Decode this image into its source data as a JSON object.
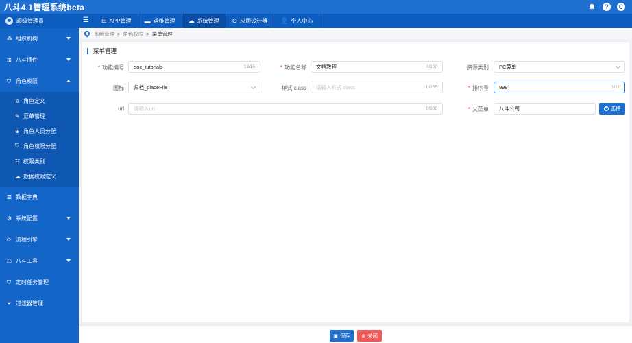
{
  "app": {
    "title": "八斗4.1管理系统beta"
  },
  "top_icons": [
    {
      "name": "bell-icon",
      "glyph": "🔔"
    },
    {
      "name": "help-icon",
      "glyph": "?"
    },
    {
      "name": "logout-icon",
      "glyph": "C"
    }
  ],
  "user": {
    "name": "超级管理员"
  },
  "nav_tabs": [
    {
      "label": "APP管理",
      "icon": "⊞"
    },
    {
      "label": "运维管理",
      "icon": "▬"
    },
    {
      "label": "系统管理",
      "icon": "☁"
    },
    {
      "label": "应用设计器",
      "icon": "⊙"
    },
    {
      "label": "个人中心",
      "icon": "👤"
    }
  ],
  "active_tab": "系统管理",
  "sidebar": {
    "items": [
      {
        "label": "组织机构",
        "icon": "⁂"
      },
      {
        "label": "八斗插件",
        "icon": "⊞"
      },
      {
        "label": "角色权限",
        "icon": "⛉"
      },
      {
        "label": "数据字典",
        "icon": "☰"
      },
      {
        "label": "系统配置",
        "icon": "⚙"
      },
      {
        "label": "流程引擎",
        "icon": "⟳"
      },
      {
        "label": "八斗工具",
        "icon": "☖"
      },
      {
        "label": "定时任务管理",
        "icon": "⛉"
      },
      {
        "label": "过滤器管理",
        "icon": "⏷"
      }
    ],
    "sub_items": [
      {
        "label": "角色定义",
        "icon": "♙"
      },
      {
        "label": "菜单管理",
        "icon": "✎"
      },
      {
        "label": "角色人员分配",
        "icon": "⊕"
      },
      {
        "label": "角色权限分配",
        "icon": "⛉"
      },
      {
        "label": "权限类别",
        "icon": "☷"
      },
      {
        "label": "数据权限定义",
        "icon": "☁"
      }
    ]
  },
  "breadcrumb": [
    "系统管理",
    "角色权限",
    "菜单管理"
  ],
  "panel": {
    "title": "菜单管理"
  },
  "form": {
    "func_code": {
      "label": "功能编号",
      "value": "doc_tutorials",
      "count": "13/15"
    },
    "func_name": {
      "label": "功能名称",
      "value": "文档教程",
      "count": "4/100"
    },
    "res_type": {
      "label": "资源类别",
      "value": "PC菜单"
    },
    "icon": {
      "label": "图标",
      "value": "归档_placeFile"
    },
    "style_class": {
      "label": "样式 class",
      "placeholder": "请输入样式 class",
      "count": "0/255"
    },
    "sort": {
      "label": "排序号",
      "value": "999",
      "count": "3/11"
    },
    "url": {
      "label": "url",
      "placeholder": "请输入url",
      "count": "0/500"
    },
    "parent": {
      "label": "父菜单",
      "value": "八斗公司"
    },
    "select_label": "选择"
  },
  "footer": {
    "save_label": "保存",
    "close_label": "关闭"
  },
  "colors": {
    "primary": "#1e6fd0",
    "sidebar": "#1465c8",
    "danger": "#ee5a5a"
  }
}
